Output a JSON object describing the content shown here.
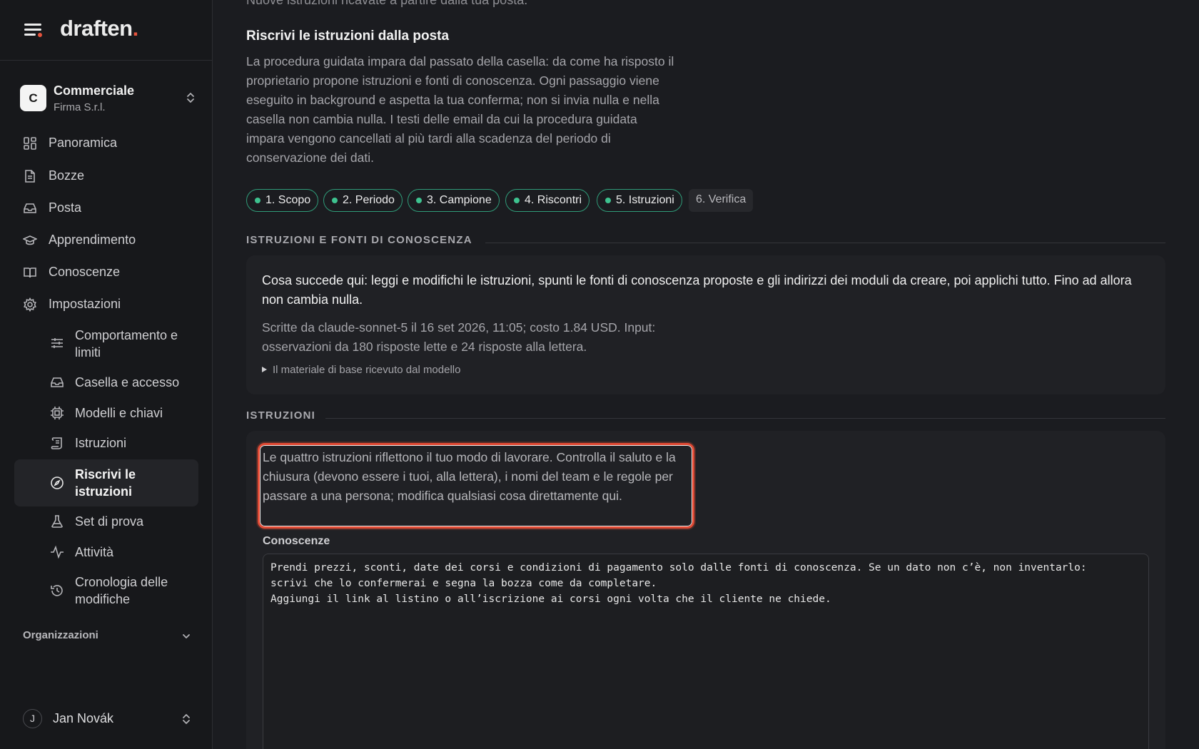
{
  "app": {
    "logo_text": "draften",
    "logo_dot": ".",
    "accent_color": "#e5533d",
    "step_color": "#3ec28f"
  },
  "org": {
    "initial": "C",
    "name": "Commerciale",
    "company": "Firma S.r.l."
  },
  "nav": {
    "items": [
      {
        "label": "Panoramica",
        "icon": "dashboard-icon"
      },
      {
        "label": "Bozze",
        "icon": "document-icon"
      },
      {
        "label": "Posta",
        "icon": "inbox-icon"
      },
      {
        "label": "Apprendimento",
        "icon": "graduation-cap-icon"
      },
      {
        "label": "Conoscenze",
        "icon": "book-icon"
      },
      {
        "label": "Impostazioni",
        "icon": "gear-icon"
      }
    ],
    "sub_items": [
      {
        "label": "Comportamento e limiti",
        "icon": "sliders-icon"
      },
      {
        "label": "Casella e accesso",
        "icon": "inbox-icon"
      },
      {
        "label": "Modelli e chiavi",
        "icon": "chip-icon"
      },
      {
        "label": "Istruzioni",
        "icon": "scroll-icon"
      },
      {
        "label": "Riscrivi le istruzioni",
        "icon": "compass-icon",
        "active": true
      },
      {
        "label": "Set di prova",
        "icon": "flask-icon"
      },
      {
        "label": "Attività",
        "icon": "activity-icon"
      },
      {
        "label": "Cronologia delle modifiche",
        "icon": "history-icon"
      }
    ],
    "organizations_label": "Organizzazioni"
  },
  "user": {
    "initial": "J",
    "name": "Jan Novák"
  },
  "main": {
    "cut_line": "Nuove istruzioni ricavate a partire dalla tua posta.",
    "title": "Riscrivi le istruzioni dalla posta",
    "intro": "La procedura guidata impara dal passato della casella: da come ha risposto il proprietario propone istruzioni e fonti di conoscenza. Ogni passaggio viene eseguito in background e aspetta la tua conferma; non si invia nulla e nella casella non cambia nulla. I testi delle email da cui la procedura guidata impara vengono cancellati al più tardi alla scadenza del periodo di conservazione dei dati.",
    "steps": [
      {
        "label": "1. Scopo",
        "done": true
      },
      {
        "label": "2. Periodo",
        "done": true
      },
      {
        "label": "3. Campione",
        "done": true
      },
      {
        "label": "4. Riscontri",
        "done": true
      },
      {
        "label": "5. Istruzioni",
        "done": true
      },
      {
        "label": "6. Verifica",
        "done": false
      }
    ],
    "section1": {
      "heading": "ISTRUZIONI E FONTI DI CONOSCENZA",
      "lead": "Cosa succede qui: leggi e modifichi le istruzioni, spunti le fonti di conoscenza proposte e gli indirizzi dei moduli da creare, poi applichi tutto. Fino ad allora non cambia nulla.",
      "meta": "Scritte da claude-sonnet-5 il 16 set 2026, 11:05; costo 1.84 USD. Input: osservazioni da 180 risposte lette e 24 risposte alla lettera.",
      "details": "Il materiale di base ricevuto dal modello"
    },
    "section2": {
      "heading": "ISTRUZIONI",
      "note": "Le quattro istruzioni riflettono il tuo modo di lavorare. Controlla il saluto e la chiusura (devono essere i tuoi, alla lettera), i nomi del team e le regole per passare a una persona; modifica qualsiasi cosa direttamente qui.",
      "knowledge_label": "Conoscenze",
      "knowledge_value": "Prendi prezzi, sconti, date dei corsi e condizioni di pagamento solo dalle fonti di conoscenza. Se un dato non c’è, non inventarlo:\nscrivi che lo confermerai e segna la bozza come da completare.\nAggiungi il link al listino o all’iscrizione ai corsi ogni volta che il cliente ne chiede."
    }
  }
}
